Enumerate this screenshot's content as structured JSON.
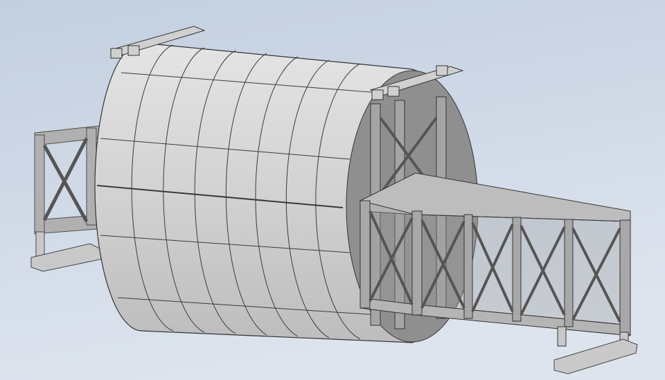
{
  "colors": {
    "background_top": "#c3cfe0",
    "background_bottom": "#dde4ee",
    "shell": "#d6d6d6",
    "shell_lines": "#3a3a3a",
    "steel": "#a9a9a9",
    "steel_dark": "#5a5a5a"
  }
}
